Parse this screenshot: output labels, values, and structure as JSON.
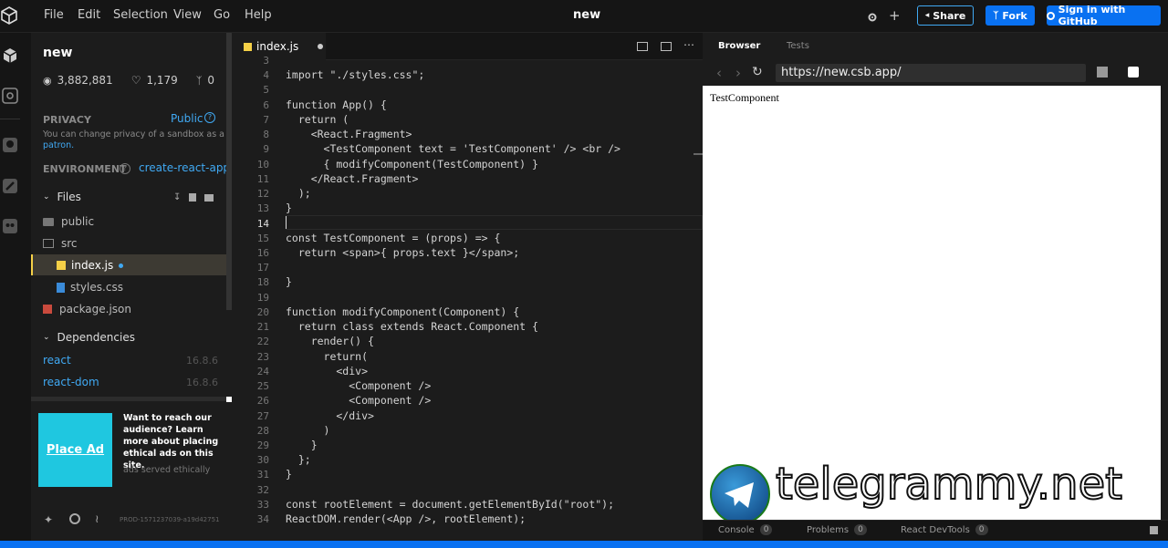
{
  "menu": {
    "items": [
      "File",
      "Edit",
      "Selection",
      "View",
      "Go",
      "Help"
    ],
    "title": "new"
  },
  "header_actions": {
    "share_label": "Share",
    "fork_label": "Fork",
    "signin_label": "Sign in with GitHub"
  },
  "sandbox": {
    "name": "new",
    "views": "3,882,881",
    "likes": "1,179",
    "forks": "0"
  },
  "privacy": {
    "label": "PRIVACY",
    "value": "Public",
    "note_prefix": "You can change privacy of a sandbox as a",
    "note_link": "patron."
  },
  "environment": {
    "label": "ENVIRONMENT",
    "value": "create-react-app"
  },
  "files": {
    "section_label": "Files",
    "items": [
      {
        "name": "public"
      },
      {
        "name": "src"
      },
      {
        "name": "index.js"
      },
      {
        "name": "styles.css"
      },
      {
        "name": "package.json"
      }
    ]
  },
  "dependencies": {
    "section_label": "Dependencies",
    "items": [
      {
        "name": "react",
        "version": "16.8.6"
      },
      {
        "name": "react-dom",
        "version": "16.8.6"
      }
    ]
  },
  "ad": {
    "button_label": "Place Ad",
    "text": "Want to reach our audience? Learn more about placing ethical ads on this site.",
    "footnote": "ads served ethically"
  },
  "footer": {
    "build": "PROD-1571237039-a19d42751"
  },
  "editor": {
    "tab_label": "index.js",
    "line_numbers": [
      "3",
      "4",
      "5",
      "6",
      "7",
      "8",
      "9",
      "10",
      "11",
      "12",
      "13",
      "14",
      "15",
      "16",
      "17",
      "18",
      "19",
      "20",
      "21",
      "22",
      "23",
      "24",
      "25",
      "26",
      "27",
      "28",
      "29",
      "30",
      "31",
      "32",
      "33",
      "34"
    ],
    "lines": [
      "",
      "import \"./styles.css\";",
      "",
      "function App() {",
      "  return (",
      "    <React.Fragment>",
      "      <TestComponent text = 'TestComponent' /> <br />",
      "      { modifyComponent(TestComponent) }",
      "    </React.Fragment>",
      "  );",
      "}",
      "",
      "const TestComponent = (props) => {",
      "  return <span>{ props.text }</span>;",
      "",
      "}",
      "",
      "function modifyComponent(Component) {",
      "  return class extends React.Component {",
      "    render() {",
      "      return(",
      "        <div>",
      "          <Component />",
      "          <Component />",
      "        </div>",
      "      )",
      "    }",
      "  };",
      "}",
      "",
      "const rootElement = document.getElementById(\"root\");",
      "ReactDOM.render(<App />, rootElement);"
    ]
  },
  "browser": {
    "tab_browser": "Browser",
    "tab_tests": "Tests",
    "url": "https://new.csb.app/",
    "preview_text": "TestComponent",
    "watermark": "telegrammy.net"
  },
  "console_bar": {
    "items": [
      {
        "label": "Console",
        "count": "0"
      },
      {
        "label": "Problems",
        "count": "0"
      },
      {
        "label": "React DevTools",
        "count": "0"
      }
    ]
  },
  "colors": {
    "accent": "#40a9f3",
    "share_border": "#40a9f3",
    "fork_bg": "#0971f1",
    "ad_bg": "#1fc7e0",
    "js_icon": "#f5d047",
    "css_icon": "#3a8bd9",
    "pkg_icon": "#c94a3d"
  }
}
